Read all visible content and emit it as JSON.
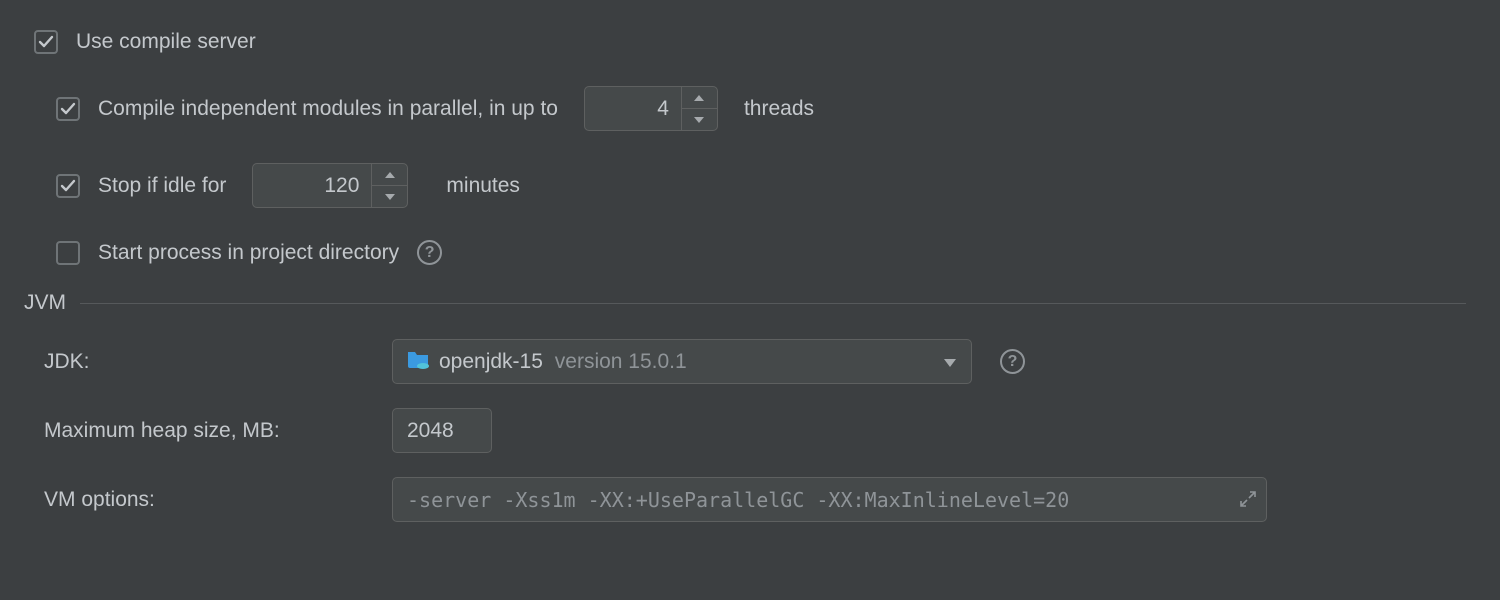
{
  "compileServer": {
    "useLabel": "Use compile server",
    "useChecked": true,
    "parallelLabel": "Compile independent modules in parallel, in up to",
    "parallelChecked": true,
    "parallelThreads": "4",
    "parallelSuffix": "threads",
    "idleLabel": "Stop if idle for",
    "idleChecked": true,
    "idleMinutes": "120",
    "idleSuffix": "minutes",
    "startInProjectDirLabel": "Start process in project directory",
    "startInProjectDirChecked": false
  },
  "jvm": {
    "sectionLabel": "JVM",
    "jdkLabel": "JDK:",
    "jdkName": "openjdk-15",
    "jdkVersion": "version 15.0.1",
    "maxHeapLabel": "Maximum heap size, MB:",
    "maxHeap": "2048",
    "vmOptionsLabel": "VM options:",
    "vmOptions": "-server -Xss1m -XX:+UseParallelGC -XX:MaxInlineLevel=20"
  }
}
